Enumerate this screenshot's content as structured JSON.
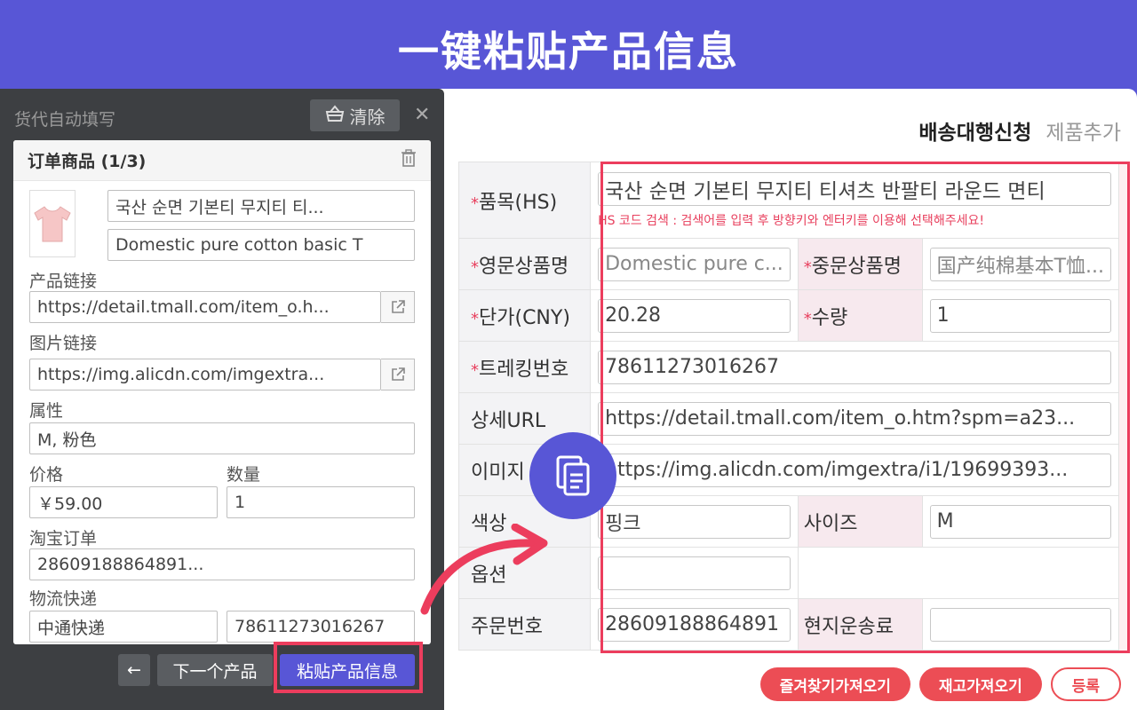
{
  "banner": {
    "title": "一键粘贴产品信息"
  },
  "form": {
    "tabs": {
      "active": "배송대행신청",
      "inactive": "제품추가"
    },
    "required_mark": "*",
    "rows": {
      "hs": {
        "label": "품목(HS)",
        "value": "국산 순면 기본티 무지티 티셔츠 반팔티 라운드 면티",
        "hint": "HS 코드 검색 : 검색어를 입력 후 방향키와 엔터키를 이용해 선택해주세요!"
      },
      "en_name": {
        "label": "영문상품명",
        "value": "Domestic pure c..."
      },
      "cn_name": {
        "label": "중문상품명",
        "value": "国产纯棉基本T恤..."
      },
      "price": {
        "label": "단가(CNY)",
        "value": "20.28"
      },
      "qty": {
        "label": "수량",
        "value": "1"
      },
      "tracking": {
        "label": "트레킹번호",
        "value": "78611273016267"
      },
      "detail_url": {
        "label": "상세URL",
        "value": "https://detail.tmall.com/item_o.htm?spm=a23..."
      },
      "image_url": {
        "label": "이미지",
        "value": "https://img.alicdn.com/imgextra/i1/19699393..."
      },
      "color": {
        "label": "색상",
        "value": "핑크"
      },
      "size": {
        "label": "사이즈",
        "value": "M"
      },
      "option": {
        "label": "옵션",
        "value": ""
      },
      "order_no": {
        "label": "주문번호",
        "value": "28609188864891"
      },
      "local_shipping": {
        "label": "현지운송료",
        "value": ""
      }
    },
    "buttons": {
      "favorites": "즐겨찾기가져오기",
      "stock": "재고가져오기",
      "register": "등록"
    }
  },
  "extension": {
    "title": "货代自动填写",
    "clear_label": "清除",
    "close": "✕",
    "card_title": "订单商品 (1/3)",
    "product_name_kr": "국산 순면 기본티 무지티 티...",
    "product_name_en": "Domestic pure cotton basic T",
    "fields": {
      "product_link": {
        "label": "产品链接",
        "value": "https://detail.tmall.com/item_o.h..."
      },
      "image_link": {
        "label": "图片链接",
        "value": "https://img.alicdn.com/imgextra..."
      },
      "attributes": {
        "label": "属性",
        "value": "M, 粉色"
      },
      "price": {
        "label": "价格",
        "value": "￥59.00"
      },
      "quantity": {
        "label": "数量",
        "value": "1"
      },
      "taobao_order": {
        "label": "淘宝订单",
        "value": "28609188864891..."
      },
      "logistics": {
        "label": "物流快递",
        "carrier": "中通快递",
        "tracking": "78611273016267"
      }
    },
    "buttons": {
      "back": "←",
      "next": "下一个产品",
      "paste": "粘贴产品信息"
    }
  },
  "colors": {
    "brand": "#5856d6",
    "accent": "#ec3d5d",
    "panel": "#3d3f42"
  }
}
